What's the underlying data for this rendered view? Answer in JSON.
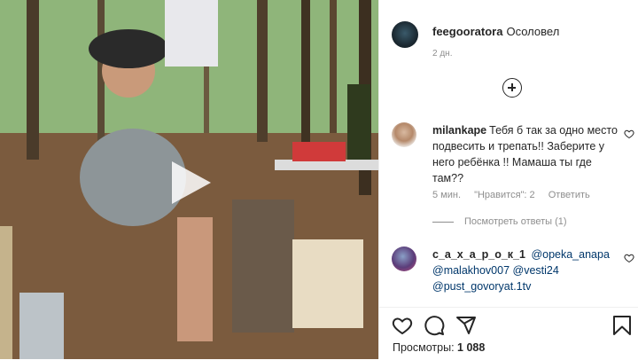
{
  "post": {
    "author": "feegooratora",
    "caption": "Осоловел",
    "time": "2 дн.",
    "views_label": "Просмотры:",
    "views_count": "1 088"
  },
  "comments": [
    {
      "user": "milankape",
      "text": "Тебя б так за одно место подвесить и трепать!! Заберите у него ребёнка !! Мамаша ты где там??",
      "time": "5 мин.",
      "likes": "\"Нравится\": 2",
      "reply_label": "Ответить",
      "view_replies": "Посмотреть ответы (1)"
    },
    {
      "user": "c_a_x_a_p_o_k_1",
      "user_display": "с_а_х_а_р_о_к_1",
      "mentions": [
        "@opeka_anapa",
        "@malakhov007",
        "@vesti24",
        "@pust_govoryat.1tv"
      ]
    }
  ],
  "icons": {
    "play": "play-icon",
    "add": "plus-circle-icon",
    "like": "heart-icon",
    "comment": "comment-icon",
    "share": "paper-plane-icon",
    "save": "bookmark-icon"
  }
}
